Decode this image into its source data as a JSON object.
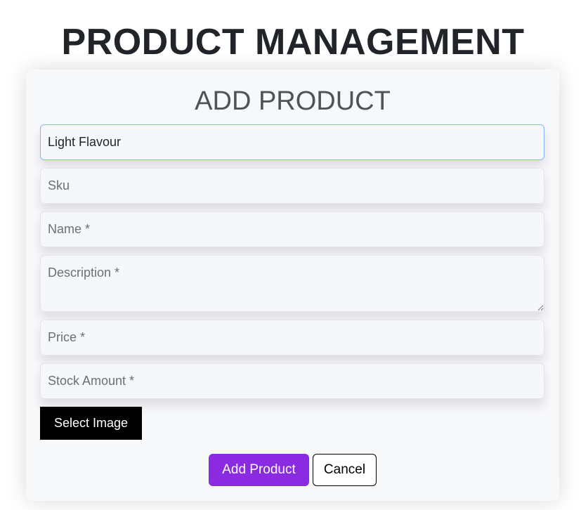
{
  "page_title": "PRODUCT MANAGEMENT",
  "form": {
    "title": "ADD PRODUCT",
    "category_value": "Light Flavour",
    "sku_placeholder": "Sku",
    "name_placeholder": "Name *",
    "description_placeholder": "Description *",
    "price_placeholder": "Price *",
    "stock_placeholder": "Stock Amount *",
    "select_image_label": "Select Image",
    "add_label": "Add Product",
    "cancel_label": "Cancel"
  }
}
